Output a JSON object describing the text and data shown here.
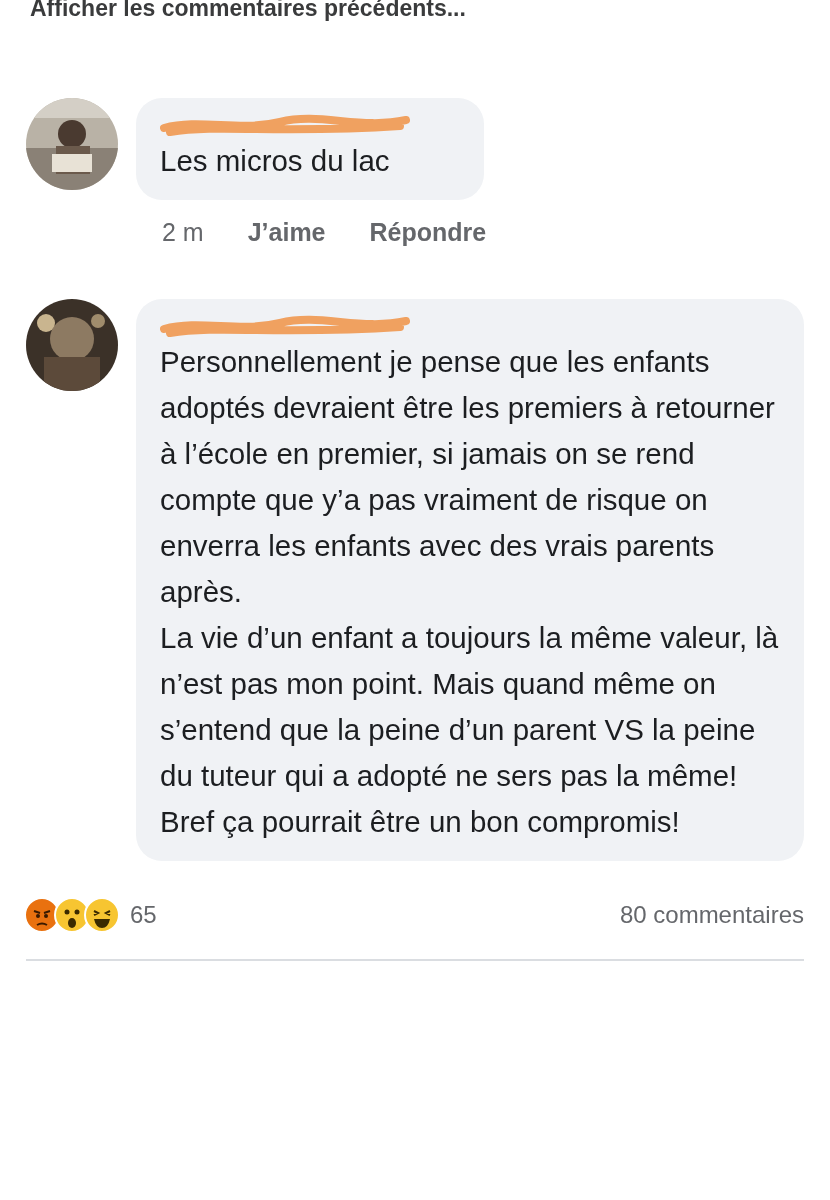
{
  "previous_link": "Afficher les commentaires précédents...",
  "comments": [
    {
      "name_redacted": true,
      "paragraphs": [
        "Les micros du lac"
      ],
      "time": "2 m",
      "actions": [
        "J’aime",
        "Répondre"
      ]
    },
    {
      "name_redacted": true,
      "paragraphs": [
        "Personnellement je pense que les enfants adoptés devraient être les premiers à retourner à l’école en premier, si jamais on se rend compte que y’a pas vraiment de risque on enverra les enfants avec des vrais parents après.",
        "La vie d’un enfant a toujours la même valeur, là n’est pas mon point. Mais quand même on s’entend que la peine d’un parent VS la peine du tuteur qui a adopté ne sers pas la même!",
        "Bref ça pourrait être un bon compromis!"
      ]
    }
  ],
  "reactions": [
    {
      "kind": "angry"
    },
    {
      "kind": "wow"
    },
    {
      "kind": "haha"
    }
  ],
  "reaction_count": "65",
  "comment_count": "80 commentaires"
}
